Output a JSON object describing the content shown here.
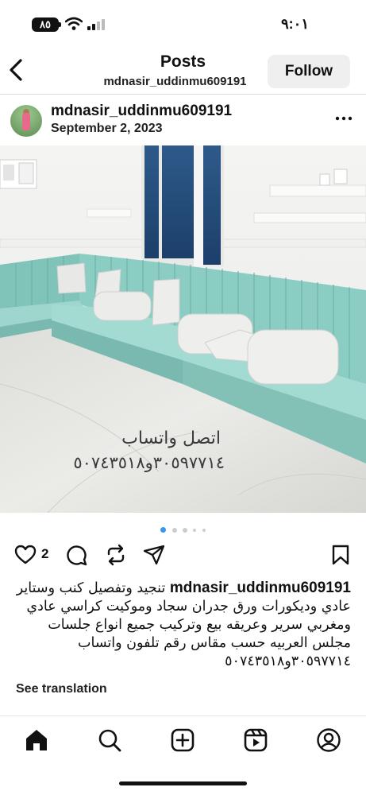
{
  "status_bar": {
    "battery": "٨٥",
    "time": "٩:٠١"
  },
  "header": {
    "title": "Posts",
    "subtitle": "mdnasir_uddinmu609191",
    "follow_label": "Follow"
  },
  "post": {
    "username": "mdnasir_uddinmu609191",
    "date": "September 2, 2023",
    "image_text": {
      "line1": "اتصل واتساب",
      "line2": "٣٠٥٩٧٧١٤و٥٠٧٤٣٥١٨"
    },
    "carousel": {
      "count": 5,
      "active_index": 0
    },
    "like_count": "2",
    "caption_user": "mdnasir_uddinmu609191",
    "caption_text": "تنجيد وتفصيل كنب وستاير عادي وديكورات ورق جدران سجاد وموكيت كراسي عادي ومغربي سرير وعريقه بيع وتركيب جميع انواع جلسات مجلس العربيه حسب مقاس رقم تلفون واتساب ٣٠٥٩٧٧١٤و٥٠٧٤٣٥١٨",
    "see_translation": "See translation"
  },
  "icons": {
    "back": "chevron-left-icon",
    "more": "more-horizontal-icon",
    "like": "heart-icon",
    "comment": "comment-icon",
    "repost": "repost-icon",
    "share": "send-icon",
    "save": "bookmark-icon",
    "nav": [
      "home-icon",
      "search-icon",
      "create-icon",
      "reels-icon",
      "profile-icon"
    ]
  },
  "colors": {
    "sofa": "#8ccdc3",
    "carousel_active": "#3897f0",
    "follow_bg": "#efefef"
  }
}
